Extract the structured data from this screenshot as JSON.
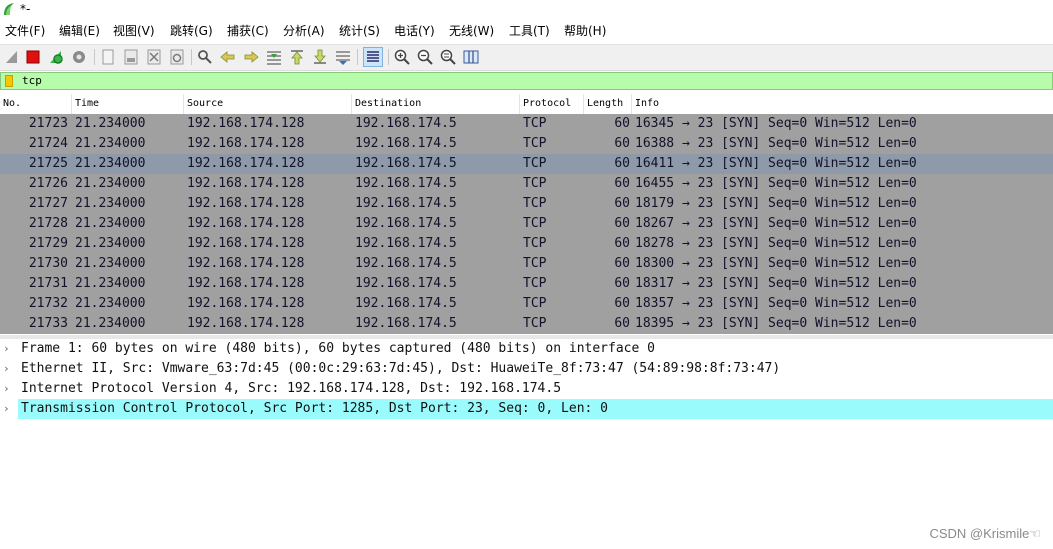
{
  "window": {
    "title": "*-"
  },
  "menu": [
    "文件(F)",
    "编辑(E)",
    "视图(V)",
    "跳转(G)",
    "捕获(C)",
    "分析(A)",
    "统计(S)",
    "电话(Y)",
    "无线(W)",
    "工具(T)",
    "帮助(H)"
  ],
  "toolbar": {
    "icons": [
      "shark-start-icon",
      "stop-icon",
      "restart-icon",
      "options-gear-icon",
      "open-file-icon",
      "save-file-icon",
      "close-file-icon",
      "reload-icon",
      "find-icon",
      "go-back-icon",
      "go-forward-icon",
      "go-to-packet-icon",
      "first-packet-icon",
      "last-packet-icon",
      "autoscroll-icon",
      "colorize-icon",
      "zoom-in-icon",
      "zoom-out-icon",
      "zoom-normal-icon",
      "resize-columns-icon"
    ]
  },
  "filter": {
    "value": "tcp"
  },
  "columns": [
    "No.",
    "Time",
    "Source",
    "Destination",
    "Protocol",
    "Length",
    "Info"
  ],
  "packets": [
    {
      "no": "21723",
      "time": "21.234000",
      "src": "192.168.174.128",
      "dst": "192.168.174.5",
      "proto": "TCP",
      "len": "60",
      "info": "16345 → 23 [SYN] Seq=0 Win=512 Len=0"
    },
    {
      "no": "21724",
      "time": "21.234000",
      "src": "192.168.174.128",
      "dst": "192.168.174.5",
      "proto": "TCP",
      "len": "60",
      "info": "16388 → 23 [SYN] Seq=0 Win=512 Len=0"
    },
    {
      "no": "21725",
      "time": "21.234000",
      "src": "192.168.174.128",
      "dst": "192.168.174.5",
      "proto": "TCP",
      "len": "60",
      "info": "16411 → 23 [SYN] Seq=0 Win=512 Len=0",
      "selected": true
    },
    {
      "no": "21726",
      "time": "21.234000",
      "src": "192.168.174.128",
      "dst": "192.168.174.5",
      "proto": "TCP",
      "len": "60",
      "info": "16455 → 23 [SYN] Seq=0 Win=512 Len=0"
    },
    {
      "no": "21727",
      "time": "21.234000",
      "src": "192.168.174.128",
      "dst": "192.168.174.5",
      "proto": "TCP",
      "len": "60",
      "info": "18179 → 23 [SYN] Seq=0 Win=512 Len=0"
    },
    {
      "no": "21728",
      "time": "21.234000",
      "src": "192.168.174.128",
      "dst": "192.168.174.5",
      "proto": "TCP",
      "len": "60",
      "info": "18267 → 23 [SYN] Seq=0 Win=512 Len=0"
    },
    {
      "no": "21729",
      "time": "21.234000",
      "src": "192.168.174.128",
      "dst": "192.168.174.5",
      "proto": "TCP",
      "len": "60",
      "info": "18278 → 23 [SYN] Seq=0 Win=512 Len=0"
    },
    {
      "no": "21730",
      "time": "21.234000",
      "src": "192.168.174.128",
      "dst": "192.168.174.5",
      "proto": "TCP",
      "len": "60",
      "info": "18300 → 23 [SYN] Seq=0 Win=512 Len=0"
    },
    {
      "no": "21731",
      "time": "21.234000",
      "src": "192.168.174.128",
      "dst": "192.168.174.5",
      "proto": "TCP",
      "len": "60",
      "info": "18317 → 23 [SYN] Seq=0 Win=512 Len=0"
    },
    {
      "no": "21732",
      "time": "21.234000",
      "src": "192.168.174.128",
      "dst": "192.168.174.5",
      "proto": "TCP",
      "len": "60",
      "info": "18357 → 23 [SYN] Seq=0 Win=512 Len=0"
    },
    {
      "no": "21733",
      "time": "21.234000",
      "src": "192.168.174.128",
      "dst": "192.168.174.5",
      "proto": "TCP",
      "len": "60",
      "info": "18395 → 23 [SYN] Seq=0 Win=512 Len=0"
    }
  ],
  "details": [
    {
      "text": "Frame 1: 60 bytes on wire (480 bits), 60 bytes captured (480 bits) on interface 0"
    },
    {
      "text": "Ethernet II, Src: Vmware_63:7d:45 (00:0c:29:63:7d:45), Dst: HuaweiTe_8f:73:47 (54:89:98:8f:73:47)"
    },
    {
      "text": "Internet Protocol Version 4, Src: 192.168.174.128, Dst: 192.168.174.5"
    },
    {
      "text": "Transmission Control Protocol, Src Port: 1285, Dst Port: 23, Seq: 0, Len: 0",
      "selected": true
    }
  ],
  "watermark": "CSDN @Krismile☜",
  "colors": {
    "packet_bg": "#a0a0a0",
    "selected_row": "#8e99aa",
    "filter_bg": "#b6fcaa",
    "detail_selected": "#9afbfc"
  }
}
